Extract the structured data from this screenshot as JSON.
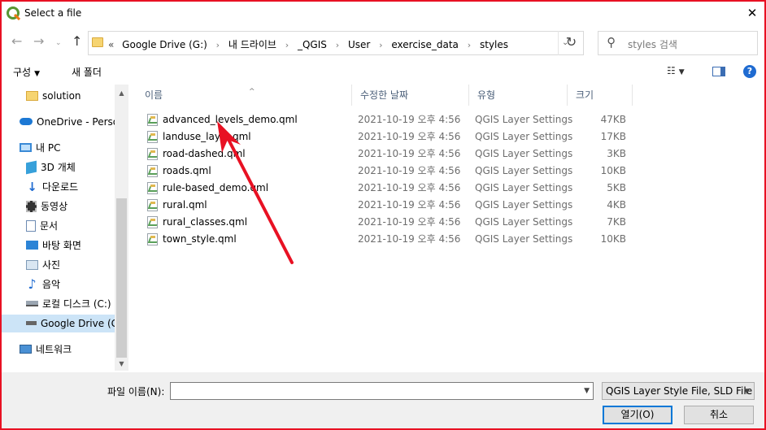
{
  "window": {
    "title": "Select a file",
    "close_glyph": "✕"
  },
  "address": {
    "prefix": "«",
    "crumbs": [
      "Google Drive (G:)",
      "내 드라이브",
      "_QGIS",
      "User",
      "exercise_data",
      "styles"
    ],
    "separator": "›",
    "refresh_glyph": "↻"
  },
  "search": {
    "placeholder": "styles 검색",
    "icon": "search-icon"
  },
  "toolbar": {
    "organize_label": "구성",
    "new_folder_label": "새 폴더",
    "view_glyph": "☷"
  },
  "sidebar": {
    "items": [
      {
        "label": "solution",
        "icon": "folder-icon"
      },
      {
        "label": "OneDrive - Person",
        "icon": "cloud-icon"
      },
      {
        "label": "내 PC",
        "icon": "computer-icon"
      },
      {
        "label": "3D 개체",
        "icon": "3d-objects-icon"
      },
      {
        "label": "다운로드",
        "icon": "download-icon"
      },
      {
        "label": "동영상",
        "icon": "video-icon"
      },
      {
        "label": "문서",
        "icon": "document-icon"
      },
      {
        "label": "바탕 화면",
        "icon": "desktop-icon"
      },
      {
        "label": "사진",
        "icon": "pictures-icon"
      },
      {
        "label": "음악",
        "icon": "music-icon"
      },
      {
        "label": "로컬 디스크 (C:)",
        "icon": "drive-icon"
      },
      {
        "label": "Google Drive (G",
        "icon": "drive-icon"
      },
      {
        "label": "네트워크",
        "icon": "network-icon"
      }
    ]
  },
  "columns": {
    "name": "이름",
    "modified": "수정한 날짜",
    "type": "유형",
    "size": "크기"
  },
  "files": [
    {
      "name": "advanced_levels_demo.qml",
      "modified": "2021-10-19 오후 4:56",
      "type": "QGIS Layer Settings",
      "size": "47KB"
    },
    {
      "name": "landuse_layer.qml",
      "modified": "2021-10-19 오후 4:56",
      "type": "QGIS Layer Settings",
      "size": "17KB"
    },
    {
      "name": "road-dashed.qml",
      "modified": "2021-10-19 오후 4:56",
      "type": "QGIS Layer Settings",
      "size": "3KB"
    },
    {
      "name": "roads.qml",
      "modified": "2021-10-19 오후 4:56",
      "type": "QGIS Layer Settings",
      "size": "10KB"
    },
    {
      "name": "rule-based_demo.qml",
      "modified": "2021-10-19 오후 4:56",
      "type": "QGIS Layer Settings",
      "size": "5KB"
    },
    {
      "name": "rural.qml",
      "modified": "2021-10-19 오후 4:56",
      "type": "QGIS Layer Settings",
      "size": "4KB"
    },
    {
      "name": "rural_classes.qml",
      "modified": "2021-10-19 오후 4:56",
      "type": "QGIS Layer Settings",
      "size": "7KB"
    },
    {
      "name": "town_style.qml",
      "modified": "2021-10-19 오후 4:56",
      "type": "QGIS Layer Settings",
      "size": "10KB"
    }
  ],
  "footer": {
    "filename_label": "파일 이름(N):",
    "filename_value": "",
    "filetype_selected": "QGIS Layer Style File, SLD File",
    "open_label": "열기(O)",
    "cancel_label": "취소"
  },
  "colors": {
    "annotation_arrow": "#e81123",
    "frame_border": "#e81123",
    "selected_sidebar": "#cce4f7",
    "accent": "#0078d7"
  }
}
